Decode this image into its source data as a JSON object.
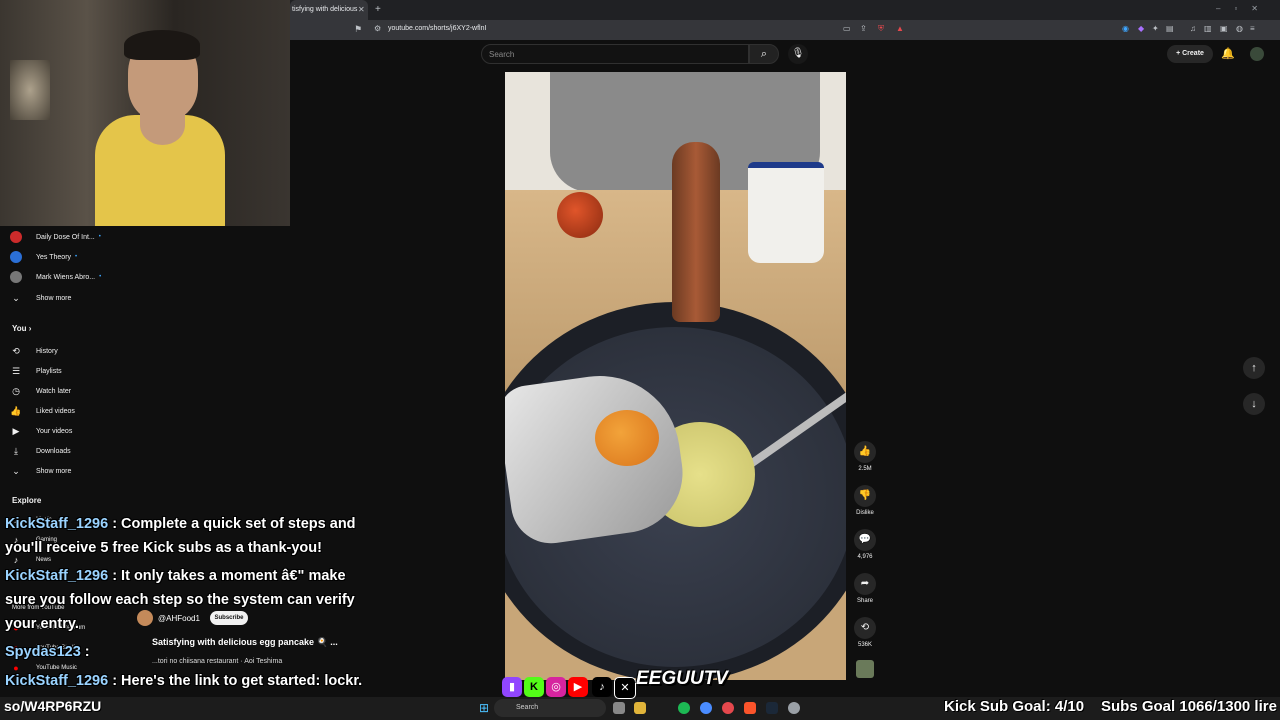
{
  "browser": {
    "tab_title": "tisfying with delicious",
    "url": "youtube.com/shorts/j6XY2-wflnI"
  },
  "header": {
    "search_placeholder": "Search",
    "create_label": "Create"
  },
  "sidebar": {
    "subscriptions": [
      {
        "label": "Daily Dose Of Int...",
        "color": "#cc2b2b"
      },
      {
        "label": "Yes Theory",
        "color": "#2b6fd6"
      },
      {
        "label": "Mark Wiens Abro...",
        "color": "#777777"
      }
    ],
    "show_more_1": "Show more",
    "you_heading": "You",
    "you_items": [
      {
        "label": "History",
        "icon": "history-icon"
      },
      {
        "label": "Playlists",
        "icon": "playlist-icon"
      },
      {
        "label": "Watch later",
        "icon": "clock-icon"
      },
      {
        "label": "Liked videos",
        "icon": "thumb-up-icon"
      },
      {
        "label": "Your videos",
        "icon": "video-icon"
      },
      {
        "label": "Downloads",
        "icon": "download-icon"
      }
    ],
    "show_more_2": "Show more",
    "explore_heading": "Explore",
    "explore_items": [
      "Music",
      "Gaming",
      "News"
    ],
    "more_heading": "More from YouTube",
    "more_items": [
      "YouTube Premium",
      "YouTube Studio",
      "YouTube Music"
    ]
  },
  "actions": {
    "likes": "2.5M",
    "dislike": "Dislike",
    "comments": "4,976",
    "share": "Share",
    "remix": "536K"
  },
  "short": {
    "channel": "@AHFood1",
    "subscribe": "Subscribe",
    "title": "Satisfying with delicious egg pancake 🍳 ...",
    "music": "...tori no chiisana restaurant · Aoi Teshima"
  },
  "chat": [
    {
      "user": "KickStaff_1296",
      "text": " : Complete a quick set of steps and"
    },
    {
      "user": "",
      "text": "you'll receive 5 free Kick subs as a thank-you!"
    },
    {
      "user": "KickStaff_1296",
      "text": " : It only takes a moment â€\" make"
    },
    {
      "user": "",
      "text": "sure you follow each step so the system can verify"
    },
    {
      "user": "",
      "text": "your entry."
    },
    {
      "user": "Spydas123",
      "text": " :"
    },
    {
      "user": "KickStaff_1296",
      "text": " : Here's the link to get started: lockr."
    }
  ],
  "overlay": {
    "promo_code": "so/W4RP6RZU",
    "kick_goal": "Kick Sub Goal: 4/10",
    "subs_goal": "Subs Goal 1066/1300 lire",
    "logo_text": "EEGUUTV"
  },
  "taskbar": {
    "search_label": "Search"
  },
  "colors": {
    "yt_bg": "#0f0f0f",
    "kick_green": "#53fc18",
    "youtube_red": "#ff0000",
    "twitch_purple": "#9146ff"
  }
}
